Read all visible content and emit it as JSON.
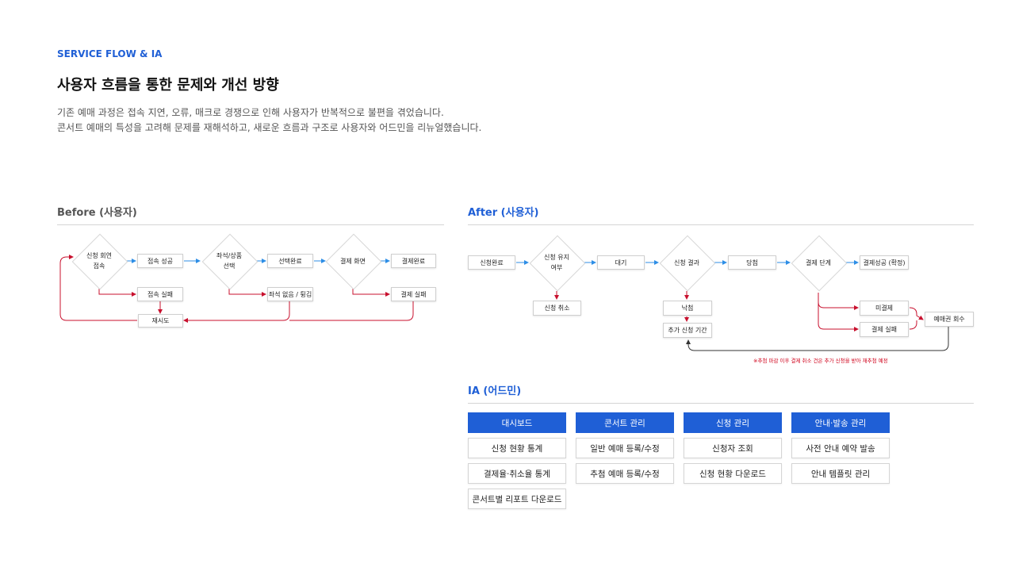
{
  "header": {
    "eyebrow": "SERVICE FLOW & IA",
    "title": "사용자 흐름을 통한 문제와 개선 방향",
    "desc_line1": "기존 예매 과정은 접속 지연, 오류, 매크로 경쟁으로 인해 사용자가 반복적으로 불편을 겪었습니다.",
    "desc_line2": "콘서트 예매의 특성을 고려해 문제를 재해석하고, 새로운 흐름과 구조로 사용자와 어드민을 리뉴얼했습니다."
  },
  "before": {
    "title": "Before (사용자)",
    "nodes": {
      "connect_try_1": "신청 회연",
      "connect_try_2": "접속",
      "connect_ok": "접속 성공",
      "seat_select_1": "좌석/상품",
      "seat_select_2": "선택",
      "select_done": "선택완료",
      "pay_screen": "결제 화면",
      "pay_done": "결제완료",
      "connect_fail": "접속 실패",
      "no_seat": "좌석 없음 / 튕김",
      "pay_fail": "결제 실패",
      "retry": "재시도"
    }
  },
  "after": {
    "title": "After (사용자)",
    "nodes": {
      "apply_done": "신청완료",
      "keep_apply_1": "신청 유지",
      "keep_apply_2": "여부",
      "wait": "대기",
      "apply_result": "신청 결과",
      "win": "당첨",
      "pay_step": "결제 단계",
      "pay_success": "결제성공 (확정)",
      "apply_cancel": "신청 취소",
      "lose": "낙첨",
      "extra_period": "추가 신청 기간",
      "unpaid": "미결제",
      "pay_fail": "결제 실패",
      "ticket_reclaim": "예매권 회수"
    },
    "note": "※추첨 마감 이후 결제 취소 건은 추가 신청을 받아 재추첨 예정"
  },
  "ia": {
    "title": "IA (어드민)",
    "columns": [
      {
        "head": "대시보드",
        "items": [
          "신청 현황 통계",
          "결제율·취소율 통계",
          "콘서트별 리포트 다운로드"
        ]
      },
      {
        "head": "콘서트 관리",
        "items": [
          "일반 예매 등록/수정",
          "추첨 예매 등록/수정"
        ]
      },
      {
        "head": "신청 관리",
        "items": [
          "신청자 조회",
          "신청 현황 다운로드"
        ]
      },
      {
        "head": "안내·발송 관리",
        "items": [
          "사전 안내 예약 발송",
          "안내 템플릿 관리"
        ]
      }
    ]
  },
  "colors": {
    "accent": "#1f5fd6",
    "arrow_blue": "#2d8ee6",
    "arrow_red": "#c8102e",
    "loop_dark": "#333333"
  }
}
